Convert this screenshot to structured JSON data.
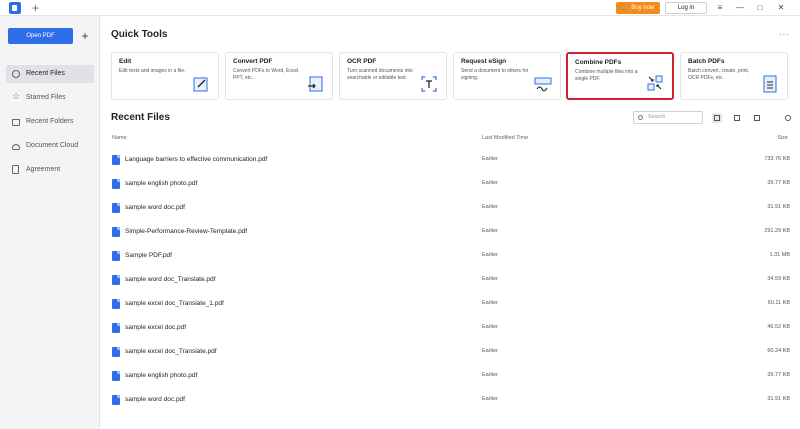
{
  "titlebar": {
    "new_tab": "+",
    "buy_now": "Buy now",
    "log_in": "Log in",
    "controls": [
      "≡",
      "—",
      "□",
      "✕"
    ],
    "buy_color": "#f58c19"
  },
  "sidebar": {
    "open_pdf": "Open PDF",
    "plus": "+",
    "items": [
      {
        "label": "Recent Files",
        "icon": "clock-icon",
        "active": true
      },
      {
        "label": "Starred Files",
        "icon": "star-icon"
      },
      {
        "label": "Recent Folders",
        "icon": "folder-icon"
      },
      {
        "label": "Document Cloud",
        "icon": "cloud-icon"
      },
      {
        "label": "Agreement",
        "icon": "agreement-icon"
      }
    ]
  },
  "quick_tools": {
    "title": "Quick Tools",
    "more": "···",
    "cards": [
      {
        "title": "Edit",
        "desc": "Edit texts and images in a file.",
        "icon": "edit-icon"
      },
      {
        "title": "Convert PDF",
        "desc": "Convert PDFs to Word, Excel, PPT, etc.",
        "icon": "convert-icon"
      },
      {
        "title": "OCR PDF",
        "desc": "Turn scanned documents into searchable or editable text.",
        "icon": "ocr-icon"
      },
      {
        "title": "Request eSign",
        "desc": "Send a document to others for signing.",
        "icon": "esign-icon"
      },
      {
        "title": "Combine PDFs",
        "desc": "Combine multiple files into a single PDF.",
        "icon": "combine-icon",
        "highlighted": true
      },
      {
        "title": "Batch PDFs",
        "desc": "Batch convert, create, print, OCR PDFs, etc.",
        "icon": "batch-icon"
      }
    ]
  },
  "recent_files": {
    "title": "Recent Files",
    "search_placeholder": "Search",
    "columns": {
      "name": "Name",
      "modified": "Last Modified Time",
      "size": "Size"
    },
    "files": [
      {
        "name": "Language barriers to effective communication.pdf",
        "modified": "Earlier",
        "size": "733.76 KB"
      },
      {
        "name": "sample english photo.pdf",
        "modified": "Earlier",
        "size": "39.77 KB"
      },
      {
        "name": "sample word doc.pdf",
        "modified": "Earlier",
        "size": "31.91 KB"
      },
      {
        "name": "Simple-Performance-Review-Template.pdf",
        "modified": "Earlier",
        "size": "291.29 KB"
      },
      {
        "name": "Sample PDF.pdf",
        "modified": "Earlier",
        "size": "1.31 MB"
      },
      {
        "name": "sample word doc_Translate.pdf",
        "modified": "Earlier",
        "size": "34.59 KB"
      },
      {
        "name": "sample excel doc_Translate_1.pdf",
        "modified": "Earlier",
        "size": "60.11 KB"
      },
      {
        "name": "sample excel doc.pdf",
        "modified": "Earlier",
        "size": "46.52 KB"
      },
      {
        "name": "sample excel doc_Translate.pdf",
        "modified": "Earlier",
        "size": "60.24 KB"
      },
      {
        "name": "sample english photo.pdf",
        "modified": "Earlier",
        "size": "39.77 KB"
      },
      {
        "name": "sample word doc.pdf",
        "modified": "Earlier",
        "size": "31.91 KB"
      }
    ]
  },
  "colors": {
    "accent": "#2f6ee8",
    "highlight_border": "#d0202a"
  }
}
